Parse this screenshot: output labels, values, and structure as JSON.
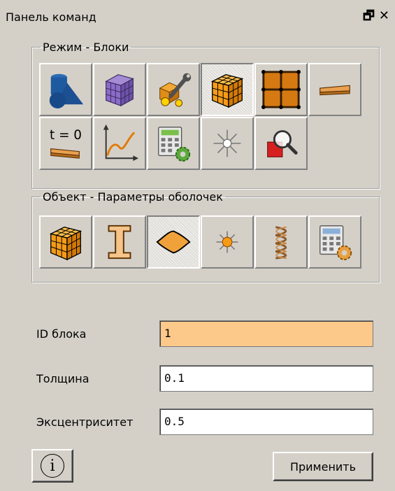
{
  "panel": {
    "title": "Панель команд"
  },
  "mode_group": {
    "legend": "Режим - Блоки",
    "buttons": [
      {
        "icon": "shapes-icon"
      },
      {
        "icon": "purple-cube-icon"
      },
      {
        "icon": "wrench-cube-icon"
      },
      {
        "icon": "orange-cube-icon",
        "selected": true
      },
      {
        "icon": "grid-icon"
      },
      {
        "icon": "plank-icon"
      },
      {
        "icon": "initial-condition-icon",
        "text": "t = 0"
      },
      {
        "icon": "curve-graph-icon"
      },
      {
        "icon": "calculator-gear-icon"
      },
      {
        "icon": "starburst-icon"
      },
      {
        "icon": "magnify-shape-icon"
      }
    ]
  },
  "object_group": {
    "legend": "Объект - Параметры оболочек",
    "buttons": [
      {
        "icon": "orange-cube-icon"
      },
      {
        "icon": "i-beam-icon"
      },
      {
        "icon": "shell-plate-icon",
        "selected": true
      },
      {
        "icon": "node-icon"
      },
      {
        "icon": "spring-icon"
      },
      {
        "icon": "calculator-gear-icon"
      }
    ]
  },
  "form": {
    "block_id_label": "ID блока",
    "block_id_value": "1",
    "thickness_label": "Толщина",
    "thickness_value": "0.1",
    "eccentricity_label": "Эксцентриситет",
    "eccentricity_value": "0.5"
  },
  "footer": {
    "info_glyph": "i",
    "apply_label": "Применить"
  },
  "colors": {
    "active_field": "#fdc98a",
    "panel_bg": "#d4d0c8"
  }
}
